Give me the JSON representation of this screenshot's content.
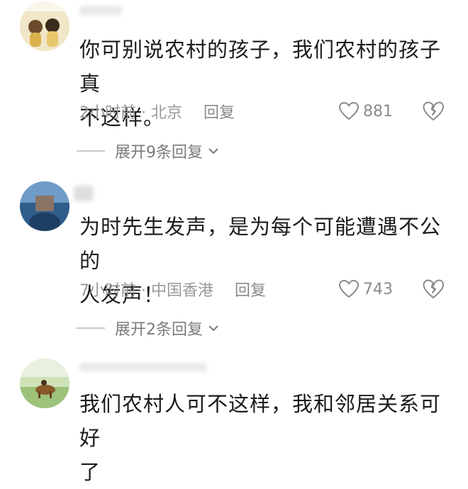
{
  "comments": [
    {
      "text_line1": "你可别说农村的孩子，我们农村的孩子真",
      "text_line2": "不这样。",
      "time_location": "2小时前 · 北京",
      "reply_label": "回复",
      "likes": "881",
      "expand_label": "展开9条回复"
    },
    {
      "text_line1": "为时先生发声，是为每个可能遭遇不公的",
      "text_line2": "人发声！",
      "time_location": "7小时前 · 中国香港",
      "reply_label": "回复",
      "likes": "743",
      "expand_label": "展开2条回复"
    },
    {
      "text_line1": "我们农村人可不这样，我和邻居关系可好",
      "text_line2": "了"
    }
  ],
  "icons": {
    "like": "heart-outline-icon",
    "dislike": "broken-heart-icon",
    "expand": "chevron-down-icon"
  },
  "colors": {
    "text": "#1b1b1b",
    "meta": "#9a9a9a",
    "icon": "#8a8a8a"
  }
}
